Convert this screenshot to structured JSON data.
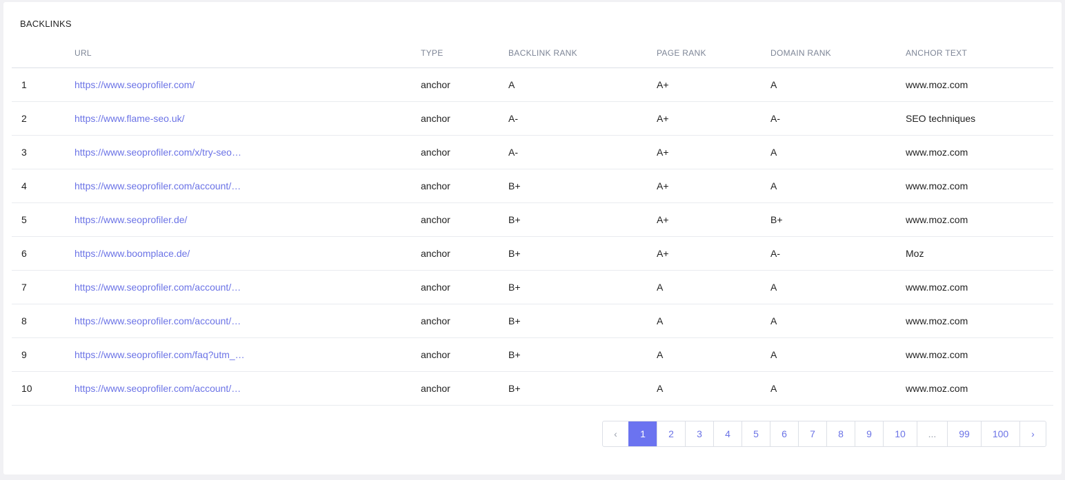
{
  "section": {
    "title": "BACKLINKS"
  },
  "table": {
    "headers": {
      "num": "",
      "url": "URL",
      "type": "TYPE",
      "backlink_rank": "BACKLINK RANK",
      "page_rank": "PAGE RANK",
      "domain_rank": "DOMAIN RANK",
      "anchor_text": "ANCHOR TEXT"
    },
    "rows": [
      {
        "num": "1",
        "url": "https://www.seoprofiler.com/",
        "type": "anchor",
        "backlink_rank": "A",
        "page_rank": "A+",
        "domain_rank": "A",
        "anchor_text": "www.moz.com"
      },
      {
        "num": "2",
        "url": "https://www.flame-seo.uk/",
        "type": "anchor",
        "backlink_rank": "A-",
        "page_rank": "A+",
        "domain_rank": "A-",
        "anchor_text": "SEO techniques"
      },
      {
        "num": "3",
        "url": "https://www.seoprofiler.com/x/try-seo…",
        "type": "anchor",
        "backlink_rank": "A-",
        "page_rank": "A+",
        "domain_rank": "A",
        "anchor_text": "www.moz.com"
      },
      {
        "num": "4",
        "url": "https://www.seoprofiler.com/account/…",
        "type": "anchor",
        "backlink_rank": "B+",
        "page_rank": "A+",
        "domain_rank": "A",
        "anchor_text": "www.moz.com"
      },
      {
        "num": "5",
        "url": "https://www.seoprofiler.de/",
        "type": "anchor",
        "backlink_rank": "B+",
        "page_rank": "A+",
        "domain_rank": "B+",
        "anchor_text": "www.moz.com"
      },
      {
        "num": "6",
        "url": "https://www.boomplace.de/",
        "type": "anchor",
        "backlink_rank": "B+",
        "page_rank": "A+",
        "domain_rank": "A-",
        "anchor_text": "Moz"
      },
      {
        "num": "7",
        "url": "https://www.seoprofiler.com/account/…",
        "type": "anchor",
        "backlink_rank": "B+",
        "page_rank": "A",
        "domain_rank": "A",
        "anchor_text": "www.moz.com"
      },
      {
        "num": "8",
        "url": "https://www.seoprofiler.com/account/…",
        "type": "anchor",
        "backlink_rank": "B+",
        "page_rank": "A",
        "domain_rank": "A",
        "anchor_text": "www.moz.com"
      },
      {
        "num": "9",
        "url": "https://www.seoprofiler.com/faq?utm_…",
        "type": "anchor",
        "backlink_rank": "B+",
        "page_rank": "A",
        "domain_rank": "A",
        "anchor_text": "www.moz.com"
      },
      {
        "num": "10",
        "url": "https://www.seoprofiler.com/account/…",
        "type": "anchor",
        "backlink_rank": "B+",
        "page_rank": "A",
        "domain_rank": "A",
        "anchor_text": "www.moz.com"
      }
    ]
  },
  "pagination": {
    "prev": "‹",
    "next": "›",
    "current": "1",
    "pages": [
      "1",
      "2",
      "3",
      "4",
      "5",
      "6",
      "7",
      "8",
      "9",
      "10",
      "...",
      "99",
      "100"
    ],
    "colors": {
      "accent": "#6b73f0",
      "link": "#6b73e6"
    }
  }
}
